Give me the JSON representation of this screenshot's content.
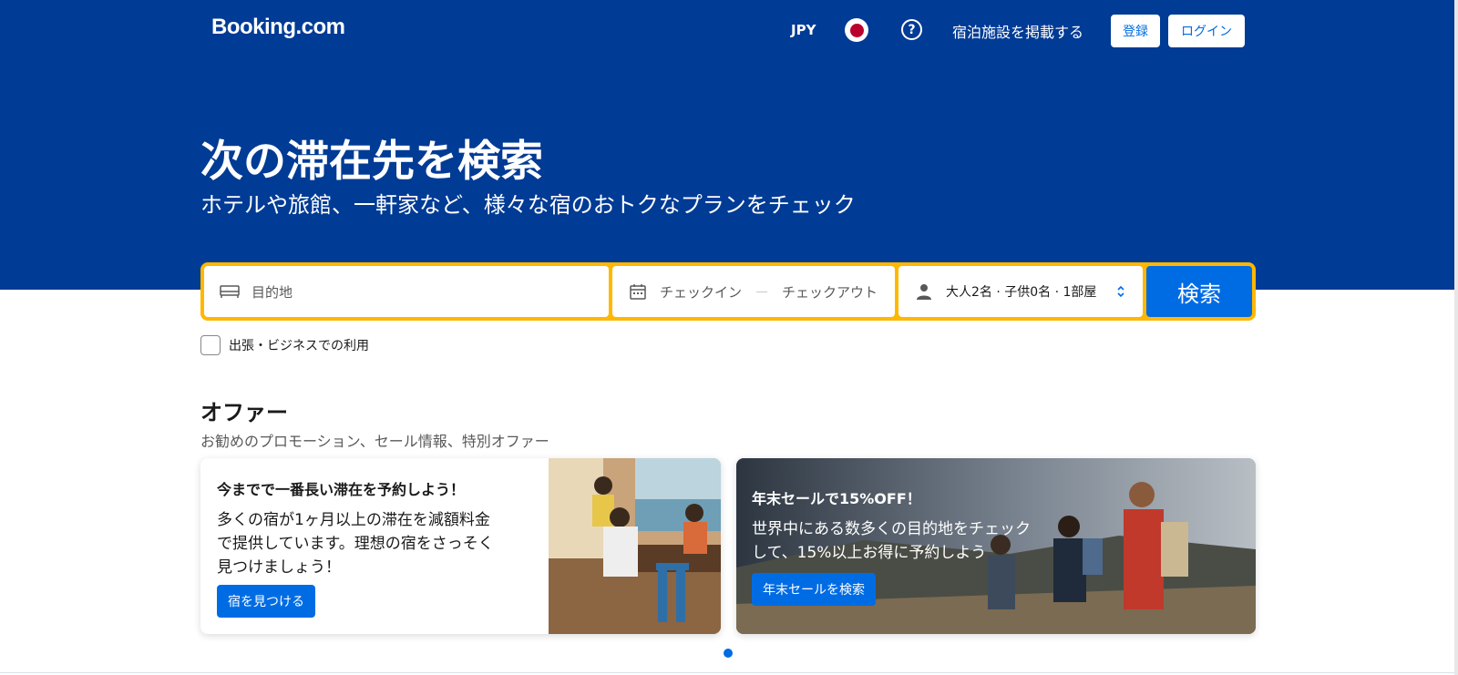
{
  "header": {
    "logo": "Booking.com",
    "currency": "JPY",
    "language_flag_icon": "japan-flag-icon",
    "help_icon": "?",
    "list_property": "宿泊施設を掲載する",
    "register": "登録",
    "login": "ログイン"
  },
  "hero": {
    "title": "次の滞在先を検索",
    "subtitle": "ホテルや旅館、一軒家など、様々な宿のおトクなプランをチェック"
  },
  "search": {
    "destination_placeholder": "目的地",
    "checkin": "チェックイン",
    "checkout": "チェックアウト",
    "guests": "大人2名 · 子供0名 · 1部屋",
    "search_button": "検索",
    "business_label": "出張・ビジネスでの利用",
    "colors": {
      "accent": "#ffb700",
      "primary": "#006ce4",
      "brand": "#003b95"
    }
  },
  "offers": {
    "title": "オファー",
    "subtitle": "お勧めのプロモーション、セール情報、特別オファー",
    "cards": [
      {
        "title": "今までで一番長い滞在を予約しよう！",
        "body_lines": [
          "多くの宿が1ヶ月以上の滞在を減額料金",
          "で提供しています。理想の宿をさっそく",
          "見つけましょう！"
        ],
        "button": "宿を見つける"
      },
      {
        "title": "年末セールで15%OFF！",
        "body_lines": [
          "世界中にある数多くの目的地をチェック",
          "して、15%以上お得に予約しよう"
        ],
        "button": "年末セールを検索"
      }
    ]
  }
}
